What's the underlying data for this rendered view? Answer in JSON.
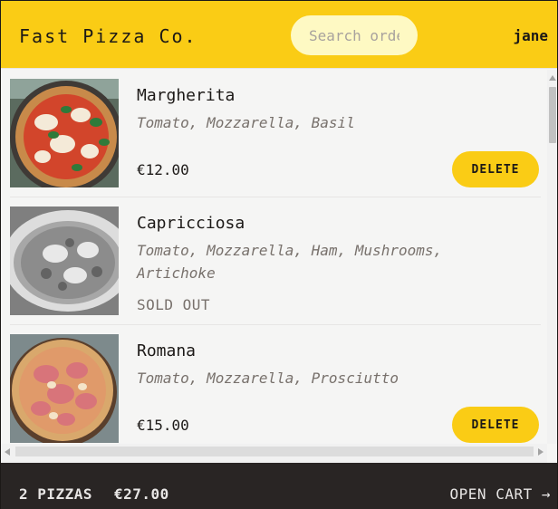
{
  "header": {
    "brand": "Fast Pizza Co.",
    "search_placeholder": "Search order #",
    "username": "jane"
  },
  "menu": {
    "items": [
      {
        "name": "Margherita",
        "ingredients": "Tomato, Mozzarella, Basil",
        "price": "€12.00",
        "sold_out": false,
        "delete_label": "DELETE"
      },
      {
        "name": "Capricciosa",
        "ingredients": "Tomato, Mozzarella, Ham, Mushrooms, Artichoke",
        "status": "SOLD OUT",
        "sold_out": true
      },
      {
        "name": "Romana",
        "ingredients": "Tomato, Mozzarella, Prosciutto",
        "price": "€15.00",
        "sold_out": false,
        "delete_label": "DELETE"
      }
    ]
  },
  "cart": {
    "count": "2 PIZZAS",
    "total": "€27.00",
    "open_label": "OPEN CART →"
  },
  "colors": {
    "accent": "#facc15",
    "background": "#f5f5f4",
    "footer": "#292524",
    "text": "#1c1917",
    "muted": "#78716c"
  }
}
